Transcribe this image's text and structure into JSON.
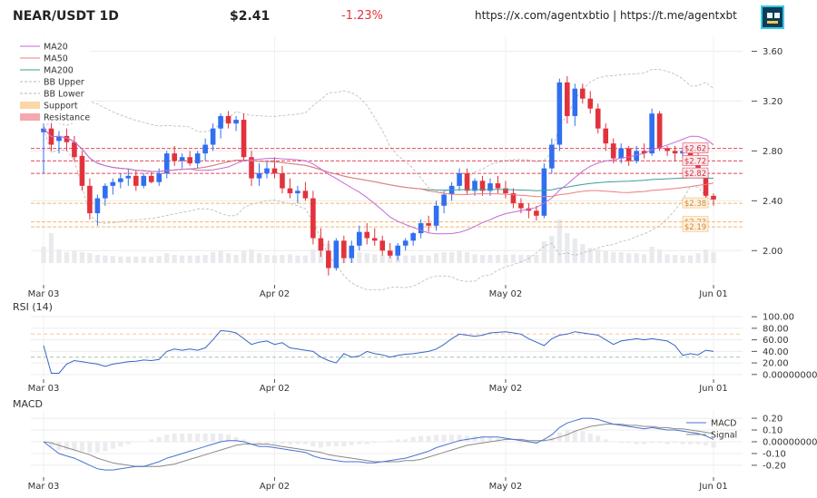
{
  "header": {
    "symbol": "NEAR/USDT 1D",
    "price": "$2.41",
    "change": "-1.23%",
    "links": "https://x.com/agentxbtio | https://t.me/agentxbt"
  },
  "colors": {
    "up": "#2f6ff0",
    "down": "#e2323c",
    "ma20": "#c46ad6",
    "ma50": "#f07c7c",
    "ma200": "#3e9e95",
    "bb": "#b8b8b8",
    "support": "#f5b76a",
    "resistance": "#e2485c",
    "rsi": "#3a64c8",
    "macd": "#4a72d4",
    "signal": "#8a8a8a"
  },
  "chart_data": [
    {
      "type": "candlestick",
      "title": "",
      "x_ticks": [
        "Mar 03",
        "Apr 02",
        "May 02",
        "Jun 01"
      ],
      "y_ticks": [
        "2.00",
        "2.40",
        "2.80",
        "3.20",
        "3.60"
      ],
      "ylim": [
        1.74,
        3.72
      ],
      "legend": [
        "MA20",
        "MA50",
        "MA200",
        "BB Upper",
        "BB Lower",
        "Support",
        "Resistance"
      ],
      "legend_position": "top-left",
      "ohlc": [
        [
          2.95,
          3.02,
          2.62,
          2.98
        ],
        [
          2.98,
          3.05,
          2.8,
          2.85
        ],
        [
          2.88,
          2.96,
          2.78,
          2.92
        ],
        [
          2.92,
          2.98,
          2.8,
          2.87
        ],
        [
          2.87,
          2.92,
          2.72,
          2.75
        ],
        [
          2.76,
          2.8,
          2.48,
          2.52
        ],
        [
          2.52,
          2.58,
          2.25,
          2.3
        ],
        [
          2.3,
          2.45,
          2.2,
          2.42
        ],
        [
          2.42,
          2.54,
          2.36,
          2.52
        ],
        [
          2.52,
          2.58,
          2.45,
          2.55
        ],
        [
          2.55,
          2.62,
          2.5,
          2.58
        ],
        [
          2.58,
          2.65,
          2.52,
          2.6
        ],
        [
          2.6,
          2.64,
          2.48,
          2.52
        ],
        [
          2.52,
          2.62,
          2.5,
          2.6
        ],
        [
          2.6,
          2.63,
          2.54,
          2.55
        ],
        [
          2.55,
          2.66,
          2.52,
          2.62
        ],
        [
          2.62,
          2.8,
          2.58,
          2.78
        ],
        [
          2.78,
          2.84,
          2.68,
          2.72
        ],
        [
          2.72,
          2.78,
          2.66,
          2.75
        ],
        [
          2.75,
          2.8,
          2.68,
          2.7
        ],
        [
          2.7,
          2.8,
          2.66,
          2.78
        ],
        [
          2.78,
          2.9,
          2.72,
          2.85
        ],
        [
          2.85,
          3.02,
          2.8,
          2.98
        ],
        [
          2.98,
          3.1,
          2.9,
          3.08
        ],
        [
          3.08,
          3.12,
          2.98,
          3.02
        ],
        [
          3.02,
          3.08,
          2.96,
          3.05
        ],
        [
          3.05,
          3.1,
          2.72,
          2.75
        ],
        [
          2.75,
          2.8,
          2.52,
          2.58
        ],
        [
          2.58,
          2.7,
          2.52,
          2.62
        ],
        [
          2.62,
          2.72,
          2.58,
          2.66
        ],
        [
          2.66,
          2.75,
          2.58,
          2.62
        ],
        [
          2.62,
          2.68,
          2.46,
          2.5
        ],
        [
          2.5,
          2.58,
          2.42,
          2.46
        ],
        [
          2.46,
          2.52,
          2.38,
          2.48
        ],
        [
          2.48,
          2.55,
          2.4,
          2.42
        ],
        [
          2.42,
          2.48,
          2.05,
          2.1
        ],
        [
          2.1,
          2.18,
          1.95,
          2.0
        ],
        [
          2.0,
          2.08,
          1.8,
          1.86
        ],
        [
          1.86,
          2.1,
          1.84,
          2.08
        ],
        [
          2.08,
          2.12,
          1.9,
          1.94
        ],
        [
          1.94,
          2.08,
          1.9,
          2.04
        ],
        [
          2.04,
          2.2,
          2.0,
          2.15
        ],
        [
          2.15,
          2.22,
          2.05,
          2.1
        ],
        [
          2.1,
          2.18,
          2.04,
          2.08
        ],
        [
          2.08,
          2.12,
          1.96,
          2.0
        ],
        [
          2.0,
          2.06,
          1.94,
          1.96
        ],
        [
          1.96,
          2.06,
          1.92,
          2.04
        ],
        [
          2.04,
          2.1,
          2.0,
          2.08
        ],
        [
          2.08,
          2.15,
          2.04,
          2.14
        ],
        [
          2.14,
          2.25,
          2.1,
          2.22
        ],
        [
          2.22,
          2.28,
          2.15,
          2.2
        ],
        [
          2.2,
          2.4,
          2.16,
          2.36
        ],
        [
          2.36,
          2.48,
          2.3,
          2.45
        ],
        [
          2.45,
          2.55,
          2.4,
          2.52
        ],
        [
          2.52,
          2.66,
          2.48,
          2.62
        ],
        [
          2.62,
          2.66,
          2.45,
          2.48
        ],
        [
          2.48,
          2.58,
          2.44,
          2.56
        ],
        [
          2.56,
          2.6,
          2.44,
          2.48
        ],
        [
          2.48,
          2.58,
          2.44,
          2.54
        ],
        [
          2.54,
          2.6,
          2.46,
          2.5
        ],
        [
          2.5,
          2.56,
          2.42,
          2.46
        ],
        [
          2.46,
          2.5,
          2.34,
          2.38
        ],
        [
          2.38,
          2.42,
          2.3,
          2.34
        ],
        [
          2.34,
          2.38,
          2.26,
          2.32
        ],
        [
          2.32,
          2.36,
          2.24,
          2.28
        ],
        [
          2.28,
          2.7,
          2.26,
          2.66
        ],
        [
          2.66,
          2.9,
          2.62,
          2.85
        ],
        [
          2.85,
          3.38,
          2.8,
          3.35
        ],
        [
          3.35,
          3.4,
          3.02,
          3.08
        ],
        [
          3.08,
          3.34,
          3.0,
          3.3
        ],
        [
          3.3,
          3.34,
          3.18,
          3.22
        ],
        [
          3.22,
          3.28,
          3.1,
          3.14
        ],
        [
          3.14,
          3.18,
          2.94,
          2.98
        ],
        [
          2.98,
          3.02,
          2.8,
          2.86
        ],
        [
          2.86,
          2.9,
          2.7,
          2.74
        ],
        [
          2.74,
          2.86,
          2.7,
          2.82
        ],
        [
          2.82,
          2.84,
          2.68,
          2.72
        ],
        [
          2.72,
          2.84,
          2.7,
          2.8
        ],
        [
          2.8,
          2.86,
          2.74,
          2.78
        ],
        [
          2.78,
          3.14,
          2.76,
          3.1
        ],
        [
          3.1,
          3.12,
          2.8,
          2.82
        ],
        [
          2.82,
          2.84,
          2.76,
          2.8
        ],
        [
          2.8,
          2.84,
          2.72,
          2.78
        ],
        [
          2.78,
          2.82,
          2.74,
          2.8
        ],
        [
          2.8,
          2.84,
          2.72,
          2.76
        ],
        [
          2.76,
          2.8,
          2.58,
          2.62
        ],
        [
          2.62,
          2.64,
          2.38,
          2.44
        ],
        [
          2.44,
          2.46,
          2.36,
          2.41
        ]
      ],
      "volume": [
        0.3,
        0.55,
        0.25,
        0.2,
        0.22,
        0.2,
        0.18,
        0.15,
        0.14,
        0.13,
        0.12,
        0.12,
        0.12,
        0.12,
        0.12,
        0.13,
        0.18,
        0.15,
        0.14,
        0.14,
        0.14,
        0.15,
        0.2,
        0.22,
        0.18,
        0.15,
        0.22,
        0.25,
        0.18,
        0.15,
        0.14,
        0.15,
        0.16,
        0.14,
        0.14,
        0.25,
        0.3,
        0.35,
        0.32,
        0.22,
        0.18,
        0.2,
        0.18,
        0.16,
        0.15,
        0.15,
        0.15,
        0.14,
        0.14,
        0.15,
        0.14,
        0.18,
        0.2,
        0.2,
        0.22,
        0.2,
        0.16,
        0.15,
        0.15,
        0.15,
        0.15,
        0.16,
        0.15,
        0.15,
        0.15,
        0.4,
        0.5,
        0.8,
        0.55,
        0.45,
        0.35,
        0.28,
        0.25,
        0.22,
        0.2,
        0.2,
        0.18,
        0.18,
        0.16,
        0.3,
        0.25,
        0.16,
        0.15,
        0.14,
        0.14,
        0.18,
        0.25,
        0.2
      ],
      "support_levels": [
        2.38,
        2.23,
        2.19
      ],
      "resistance_levels": [
        2.62,
        2.72,
        2.82
      ],
      "level_labels": [
        "$2.82",
        "$2.72",
        "$2.62",
        "$2.38",
        "$2.23",
        "$2.19"
      ]
    },
    {
      "type": "line",
      "title": "RSI (14)",
      "x_ticks": [
        "Mar 03",
        "Apr 02",
        "May 02",
        "Jun 01"
      ],
      "y_ticks": [
        "0.00000000",
        "20.00",
        "40.00",
        "60.00",
        "80.00",
        "100.00"
      ],
      "ylim": [
        -5,
        105
      ],
      "reference_lines": [
        70,
        30
      ],
      "series": [
        {
          "values": [
            50,
            2,
            2,
            18,
            24,
            22,
            20,
            18,
            14,
            18,
            20,
            22,
            23,
            25,
            24,
            26,
            40,
            44,
            42,
            44,
            42,
            46,
            60,
            76,
            75,
            72,
            62,
            52,
            56,
            58,
            52,
            55,
            46,
            44,
            42,
            40,
            30,
            24,
            20,
            36,
            30,
            32,
            40,
            36,
            34,
            30,
            33,
            35,
            36,
            38,
            40,
            44,
            52,
            62,
            70,
            68,
            66,
            68,
            72,
            73,
            74,
            72,
            70,
            62,
            56,
            50,
            62,
            68,
            70,
            74,
            72,
            70,
            68,
            60,
            52,
            58,
            60,
            62,
            60,
            62,
            60,
            58,
            50,
            33,
            36,
            34,
            42,
            40
          ]
        }
      ]
    },
    {
      "type": "line",
      "title": "MACD",
      "x_ticks": [
        "Mar 03",
        "Apr 02",
        "May 02",
        "Jun 01"
      ],
      "y_ticks": [
        "-0.20",
        "-0.10",
        "0.00000000",
        "0.10",
        "0.20"
      ],
      "ylim": [
        -0.27,
        0.27
      ],
      "legend": [
        "MACD",
        "Signal"
      ],
      "legend_position": "right",
      "series": [
        {
          "name": "MACD",
          "values": [
            0.0,
            -0.05,
            -0.1,
            -0.12,
            -0.14,
            -0.17,
            -0.2,
            -0.23,
            -0.24,
            -0.24,
            -0.23,
            -0.22,
            -0.21,
            -0.21,
            -0.19,
            -0.17,
            -0.14,
            -0.12,
            -0.1,
            -0.08,
            -0.06,
            -0.04,
            -0.02,
            0.0,
            0.01,
            0.01,
            0.0,
            -0.02,
            -0.04,
            -0.04,
            -0.05,
            -0.06,
            -0.07,
            -0.08,
            -0.09,
            -0.12,
            -0.14,
            -0.15,
            -0.16,
            -0.17,
            -0.17,
            -0.17,
            -0.18,
            -0.18,
            -0.17,
            -0.16,
            -0.15,
            -0.14,
            -0.12,
            -0.1,
            -0.08,
            -0.05,
            -0.03,
            -0.01,
            0.01,
            0.02,
            0.03,
            0.04,
            0.04,
            0.04,
            0.03,
            0.02,
            0.01,
            0.0,
            -0.01,
            0.02,
            0.06,
            0.12,
            0.16,
            0.18,
            0.2,
            0.2,
            0.19,
            0.17,
            0.15,
            0.14,
            0.13,
            0.12,
            0.11,
            0.12,
            0.11,
            0.1,
            0.1,
            0.09,
            0.08,
            0.07,
            0.05,
            0.02
          ]
        },
        {
          "name": "Signal",
          "values": [
            0.0,
            -0.01,
            -0.03,
            -0.05,
            -0.07,
            -0.09,
            -0.11,
            -0.14,
            -0.16,
            -0.18,
            -0.19,
            -0.2,
            -0.21,
            -0.21,
            -0.21,
            -0.21,
            -0.2,
            -0.19,
            -0.17,
            -0.15,
            -0.13,
            -0.11,
            -0.09,
            -0.07,
            -0.05,
            -0.03,
            -0.02,
            -0.02,
            -0.02,
            -0.02,
            -0.03,
            -0.04,
            -0.05,
            -0.06,
            -0.07,
            -0.08,
            -0.09,
            -0.11,
            -0.12,
            -0.13,
            -0.14,
            -0.15,
            -0.16,
            -0.17,
            -0.17,
            -0.17,
            -0.17,
            -0.16,
            -0.16,
            -0.15,
            -0.13,
            -0.11,
            -0.09,
            -0.07,
            -0.05,
            -0.03,
            -0.02,
            -0.01,
            0.0,
            0.01,
            0.02,
            0.02,
            0.02,
            0.01,
            0.01,
            0.01,
            0.02,
            0.04,
            0.06,
            0.09,
            0.11,
            0.13,
            0.14,
            0.15,
            0.15,
            0.15,
            0.14,
            0.14,
            0.13,
            0.13,
            0.12,
            0.12,
            0.11,
            0.11,
            0.1,
            0.09,
            0.08,
            0.07
          ]
        }
      ]
    }
  ]
}
